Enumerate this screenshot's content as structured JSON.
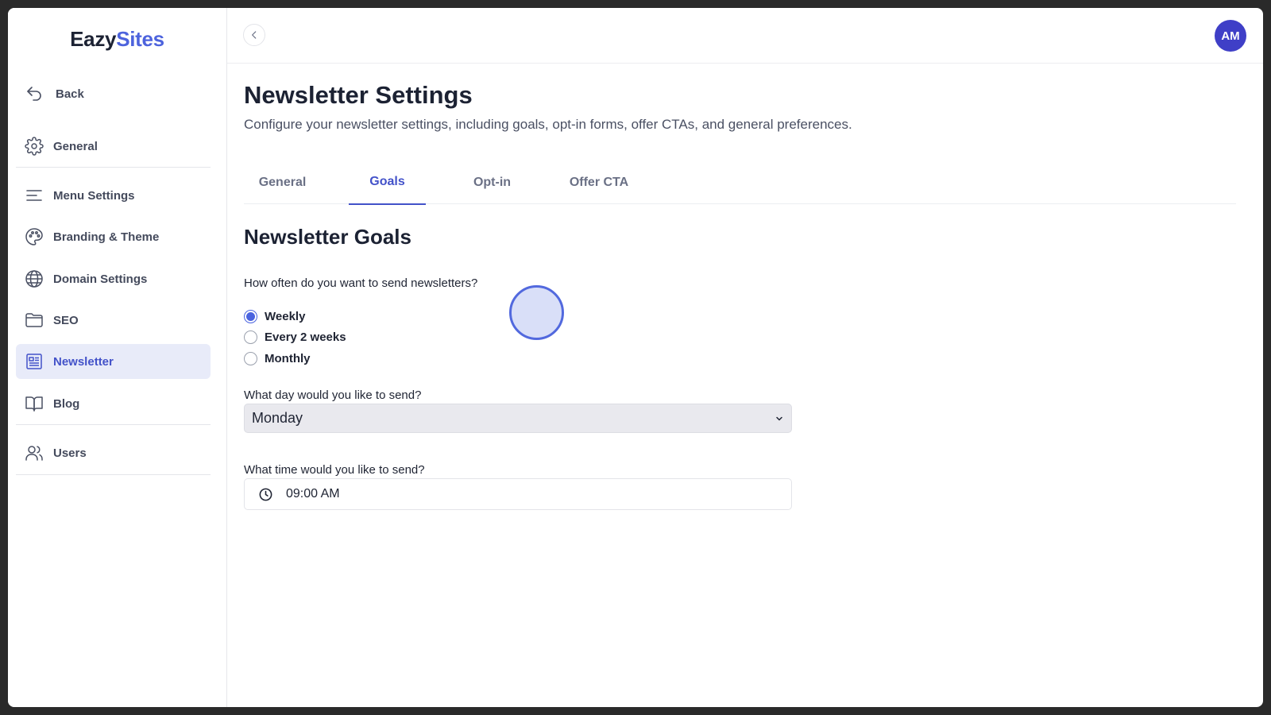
{
  "app": {
    "logo_part1": "Eazy",
    "logo_part2": "Sites",
    "brand_color": "#4d63dd",
    "accent_color": "#4352c9"
  },
  "sidebar": {
    "items": [
      {
        "label": "Back",
        "icon": "back-arrow-icon"
      },
      {
        "label": "General",
        "icon": "gear-icon"
      },
      {
        "label": "Menu Settings",
        "icon": "menu-lines-icon"
      },
      {
        "label": "Branding & Theme",
        "icon": "palette-icon"
      },
      {
        "label": "Domain Settings",
        "icon": "globe-icon"
      },
      {
        "label": "SEO",
        "icon": "folder-icon"
      },
      {
        "label": "Newsletter",
        "icon": "newspaper-icon",
        "active": true
      },
      {
        "label": "Blog",
        "icon": "book-icon"
      },
      {
        "label": "Users",
        "icon": "users-icon"
      }
    ]
  },
  "header": {
    "avatar_initials": "AM",
    "collapse_icon": "chevron-left-icon"
  },
  "main": {
    "title": "Newsletter Settings",
    "subtitle": "Configure your newsletter settings, including goals, opt-in forms, offer CTAs, and general preferences.",
    "tabs": [
      {
        "label": "General"
      },
      {
        "label": "Goals",
        "active": true
      },
      {
        "label": "Opt-in"
      },
      {
        "label": "Offer CTA"
      }
    ],
    "section_title": "Newsletter Goals",
    "frequency": {
      "question": "How often do you want to send newsletters?",
      "options": [
        "Weekly",
        "Every 2 weeks",
        "Monthly"
      ],
      "selected": "Weekly"
    },
    "day": {
      "question": "What day would you like to send?",
      "value": "Monday"
    },
    "time": {
      "question": "What time would you like to send?",
      "value": "09:00 AM",
      "icon": "clock-icon"
    }
  }
}
